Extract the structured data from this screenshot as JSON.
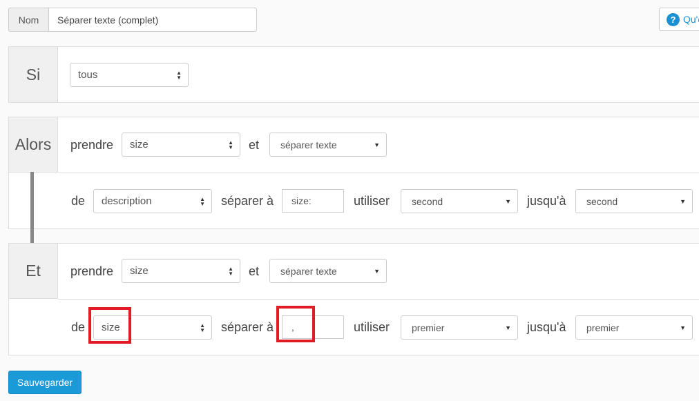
{
  "name": {
    "label": "Nom",
    "value": "Séparer texte (complet)"
  },
  "help": {
    "label": "Qu'e"
  },
  "si": {
    "label": "Si",
    "condition": "tous"
  },
  "alors": {
    "label": "Alors",
    "word_prendre": "prendre",
    "take_field": "size",
    "word_et": "et",
    "action": "séparer texte",
    "word_de": "de",
    "source_field": "description",
    "word_separer": "séparer à",
    "separator": "size:",
    "word_utiliser": "utiliser",
    "use": "second",
    "word_jusqua": "jusqu'à",
    "until": "second"
  },
  "et": {
    "label": "Et",
    "word_prendre": "prendre",
    "take_field": "size",
    "word_et": "et",
    "action": "séparer texte",
    "word_de": "de",
    "source_field": "size",
    "word_separer": "séparer à",
    "separator": ",",
    "word_utiliser": "utiliser",
    "use": "premier",
    "word_jusqua": "jusqu'à",
    "until": "premier"
  },
  "save_label": "Sauvegarder",
  "colors": {
    "accent": "#1a9ad6",
    "highlight": "#e01b24"
  }
}
